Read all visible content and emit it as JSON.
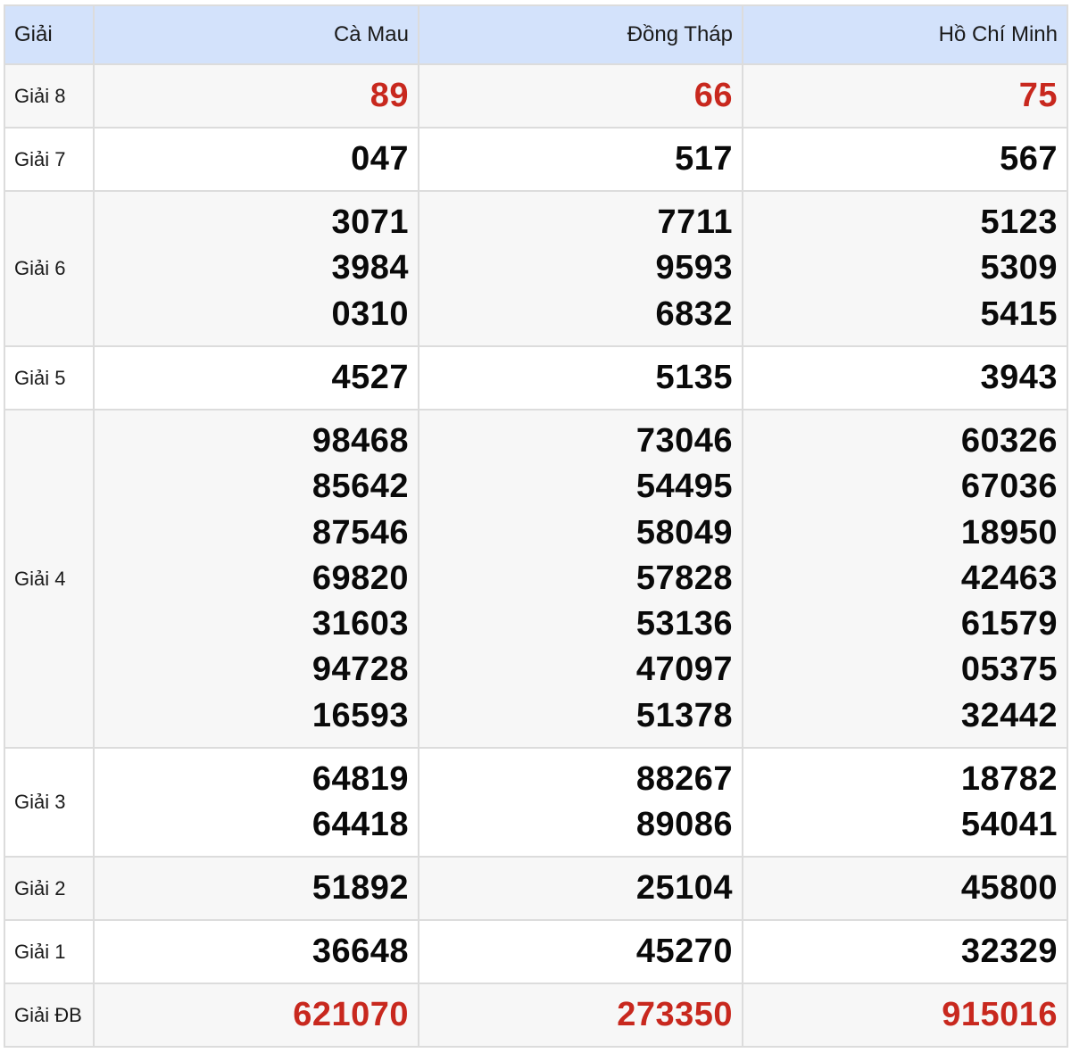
{
  "header": {
    "prize": "Giải",
    "provinces": [
      "Cà Mau",
      "Đồng Tháp",
      "Hồ Chí Minh"
    ]
  },
  "rows": [
    {
      "label": "Giải 8",
      "values": [
        [
          "89"
        ],
        [
          "66"
        ],
        [
          "75"
        ]
      ],
      "highlight": true
    },
    {
      "label": "Giải 7",
      "values": [
        [
          "047"
        ],
        [
          "517"
        ],
        [
          "567"
        ]
      ],
      "highlight": false
    },
    {
      "label": "Giải 6",
      "values": [
        [
          "3071",
          "3984",
          "0310"
        ],
        [
          "7711",
          "9593",
          "6832"
        ],
        [
          "5123",
          "5309",
          "5415"
        ]
      ],
      "highlight": false
    },
    {
      "label": "Giải 5",
      "values": [
        [
          "4527"
        ],
        [
          "5135"
        ],
        [
          "3943"
        ]
      ],
      "highlight": false
    },
    {
      "label": "Giải 4",
      "values": [
        [
          "98468",
          "85642",
          "87546",
          "69820",
          "31603",
          "94728",
          "16593"
        ],
        [
          "73046",
          "54495",
          "58049",
          "57828",
          "53136",
          "47097",
          "51378"
        ],
        [
          "60326",
          "67036",
          "18950",
          "42463",
          "61579",
          "05375",
          "32442"
        ]
      ],
      "highlight": false
    },
    {
      "label": "Giải 3",
      "values": [
        [
          "64819",
          "64418"
        ],
        [
          "88267",
          "89086"
        ],
        [
          "18782",
          "54041"
        ]
      ],
      "highlight": false
    },
    {
      "label": "Giải 2",
      "values": [
        [
          "51892"
        ],
        [
          "25104"
        ],
        [
          "45800"
        ]
      ],
      "highlight": false
    },
    {
      "label": "Giải 1",
      "values": [
        [
          "36648"
        ],
        [
          "45270"
        ],
        [
          "32329"
        ]
      ],
      "highlight": false
    },
    {
      "label": "Giải ĐB",
      "values": [
        [
          "621070"
        ],
        [
          "273350"
        ],
        [
          "915016"
        ]
      ],
      "highlight": true
    }
  ],
  "colors": {
    "header_bg": "#d3e2fb",
    "highlight_number": "#c8281e",
    "number": "#0a0a0a"
  }
}
